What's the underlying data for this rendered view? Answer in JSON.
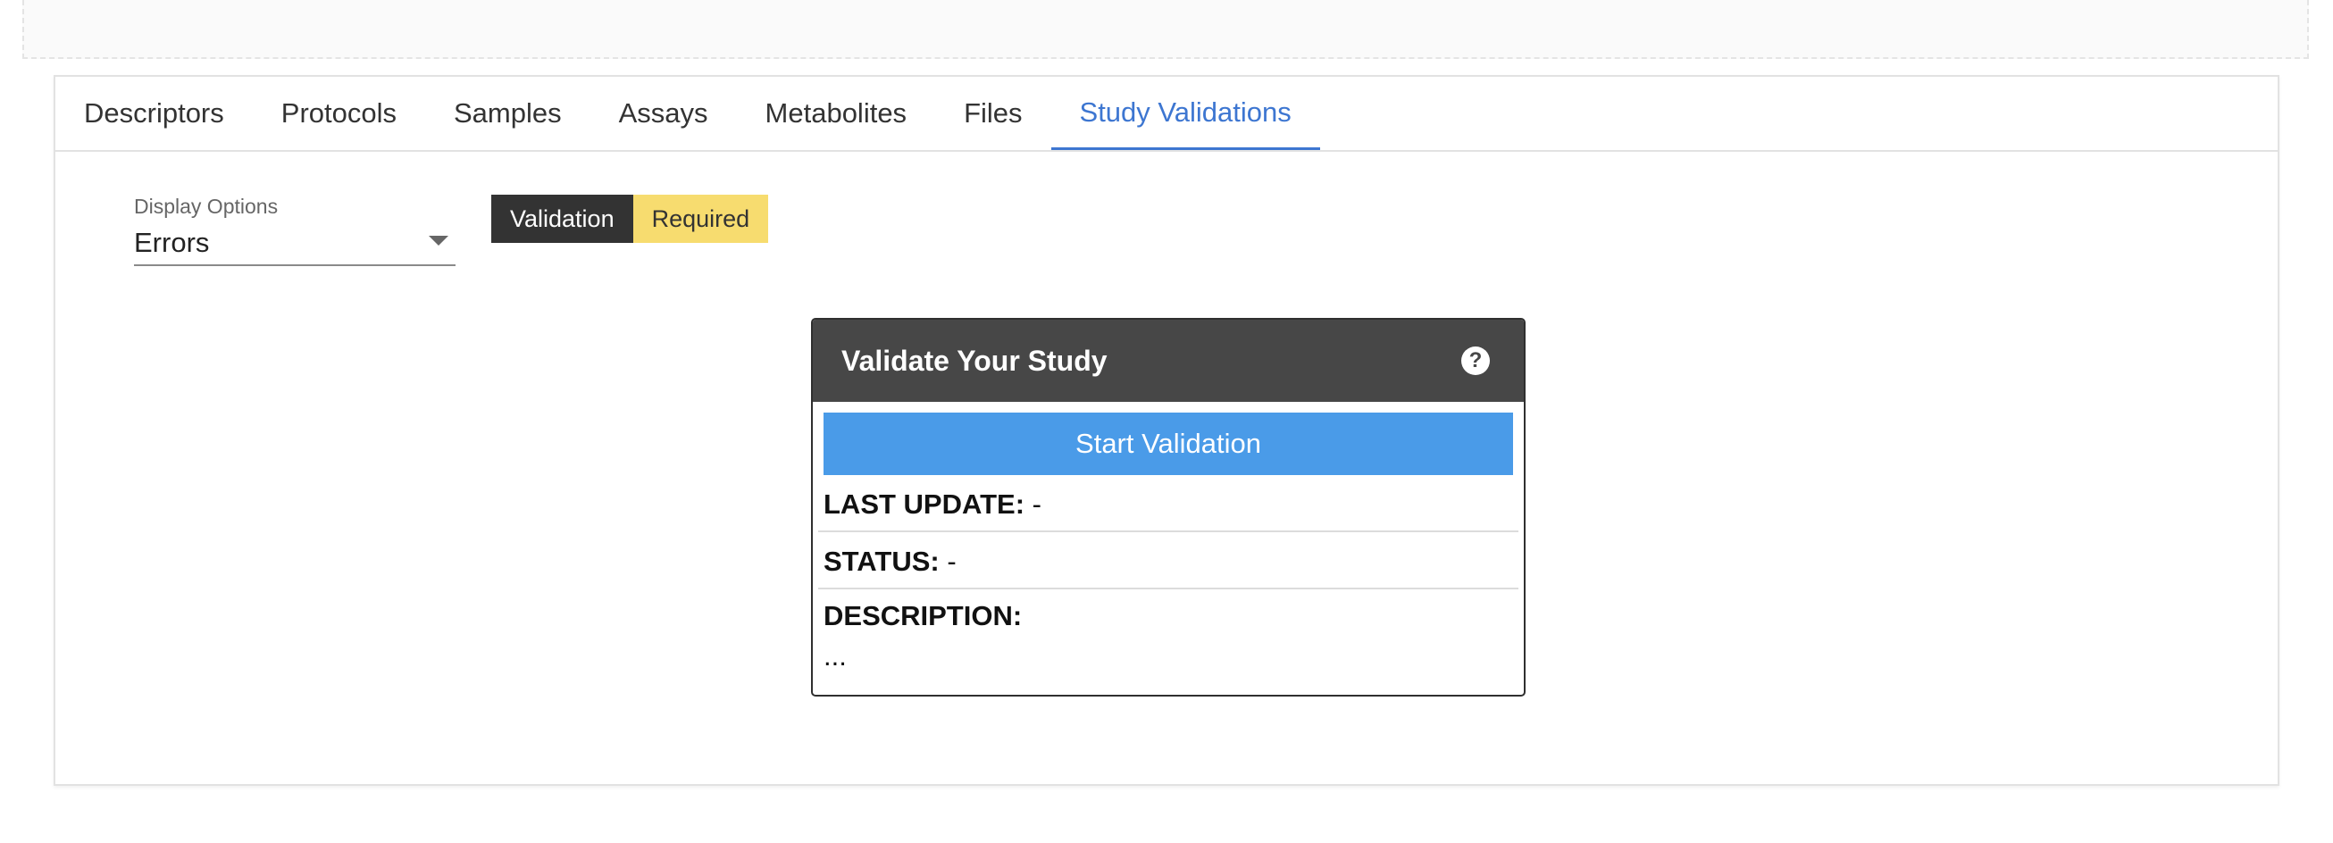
{
  "tabs": [
    {
      "label": "Descriptors",
      "active": false
    },
    {
      "label": "Protocols",
      "active": false
    },
    {
      "label": "Samples",
      "active": false
    },
    {
      "label": "Assays",
      "active": false
    },
    {
      "label": "Metabolites",
      "active": false
    },
    {
      "label": "Files",
      "active": false
    },
    {
      "label": "Study Validations",
      "active": true
    }
  ],
  "display_options": {
    "label": "Display Options",
    "selected": "Errors"
  },
  "badges": {
    "validation": "Validation",
    "required": "Required"
  },
  "validate_panel": {
    "title": "Validate Your Study",
    "help_icon": "question-circle-icon",
    "start_button": "Start Validation",
    "last_update_label": "LAST UPDATE:",
    "last_update_value": "-",
    "status_label": "STATUS:",
    "status_value": "-",
    "description_label": "DESCRIPTION:",
    "description_value": "..."
  },
  "colors": {
    "active_tab": "#3d76d1",
    "panel_header": "#474747",
    "start_button": "#4a9be8",
    "required_badge": "#f7dc6f",
    "validation_badge": "#333333"
  }
}
